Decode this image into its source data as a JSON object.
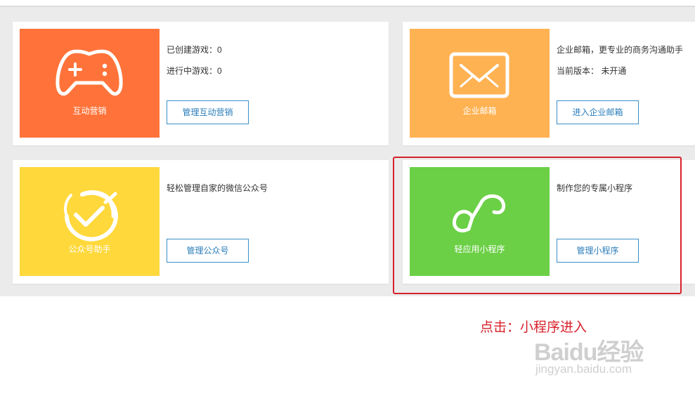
{
  "cards": [
    {
      "tile_label": "互动营销",
      "tile_color": "#ff733a",
      "icon": "gamepad-icon",
      "lines": [
        "已创建游戏：0",
        "进行中游戏：0"
      ],
      "button": "管理互动营销"
    },
    {
      "tile_label": "企业邮箱",
      "tile_color": "#ffb252",
      "icon": "envelope-icon",
      "lines": [
        "企业邮箱，更专业的商务沟通助手",
        "当前版本：  未开通"
      ],
      "button": "进入企业邮箱"
    },
    {
      "tile_label": "公众号助手",
      "tile_color": "#ffd83b",
      "icon": "checkmark-circle-icon",
      "lines": [
        "轻松管理自家的微信公众号"
      ],
      "button": "管理公众号"
    },
    {
      "tile_label": "轻应用小程序",
      "tile_color": "#6bd046",
      "icon": "mini-program-icon",
      "lines": [
        "制作您的专属小程序"
      ],
      "button": "管理小程序"
    }
  ],
  "annotation": {
    "text": "点击：小程序进入",
    "color": "#d7212b"
  },
  "watermark": {
    "brand": "Baidu经验",
    "site": "jingyan.baidu.com"
  }
}
